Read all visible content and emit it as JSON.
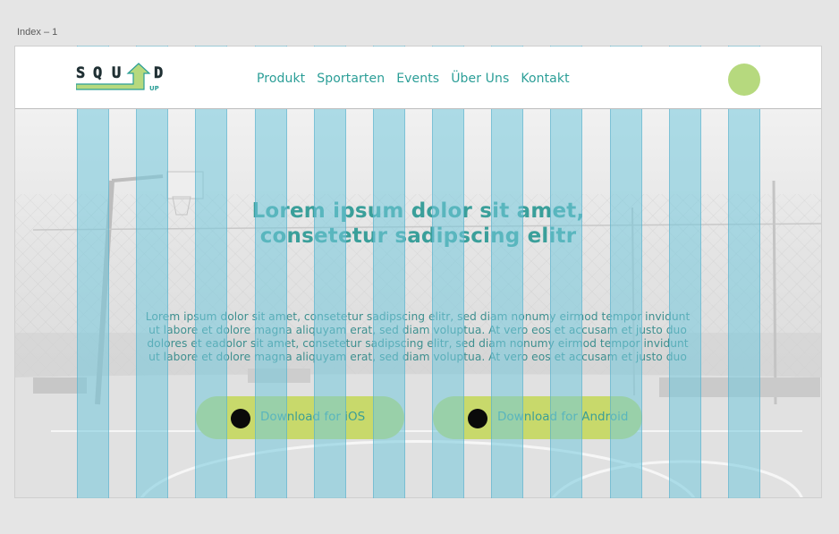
{
  "frame": {
    "label": "Index – 1"
  },
  "header": {
    "logo": {
      "text": "SQU D",
      "sub_text": "UP",
      "icon": "arrow-up-icon"
    },
    "nav": [
      "Produkt",
      "Sportarten",
      "Events",
      "Über Uns",
      "Kontakt"
    ]
  },
  "hero": {
    "headline_line1": "Lorem ipsum dolor sit amet,",
    "headline_line2": "consetetur sadipscing elitr",
    "body": "Lorem ipsum dolor sit amet, consetetur sadipscing elitr, sed diam nonumy eirmod tempor invidunt ut labore et dolore magna aliquyam erat, sed diam voluptua. At vero eos et accusam et justo duo dolores et eadolor sit amet, consetetur sadipscing elitr, sed diam nonumy eirmod tempor invidunt ut labore et dolore magna aliquyam erat, sed diam voluptua. At vero eos et accusam et justo duo",
    "buttons": {
      "ios": "Download for iOS",
      "android": "Download for Android"
    }
  },
  "colors": {
    "accent": "#2b9e97",
    "button": "#c8d96b",
    "avatar": "#b6d97e",
    "grid_overlay": "#73c8dc"
  },
  "layout_grid": {
    "columns": 12
  }
}
